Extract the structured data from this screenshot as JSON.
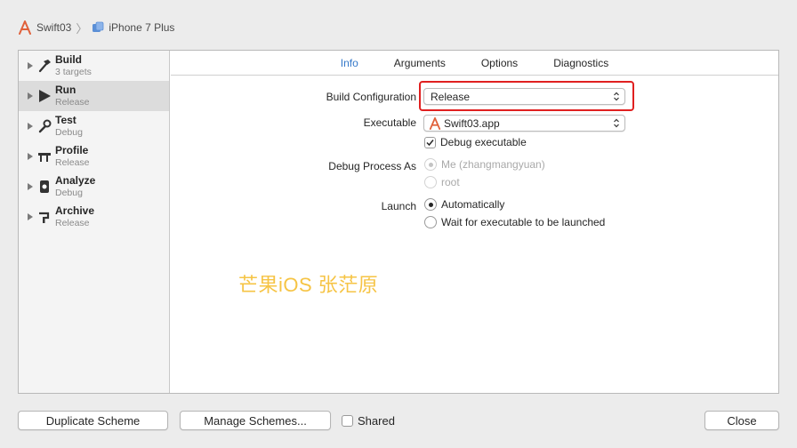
{
  "breadcrumb": {
    "project": "Swift03",
    "device": "iPhone 7 Plus"
  },
  "sidebar": {
    "items": [
      {
        "name": "Build",
        "sub": "3 targets",
        "icon": "hammer-icon"
      },
      {
        "name": "Run",
        "sub": "Release",
        "icon": "play-icon"
      },
      {
        "name": "Test",
        "sub": "Debug",
        "icon": "wrench-icon"
      },
      {
        "name": "Profile",
        "sub": "Release",
        "icon": "instruments-icon"
      },
      {
        "name": "Analyze",
        "sub": "Debug",
        "icon": "analyze-icon"
      },
      {
        "name": "Archive",
        "sub": "Release",
        "icon": "archive-icon"
      }
    ],
    "selected": "Run"
  },
  "tabs": [
    "Info",
    "Arguments",
    "Options",
    "Diagnostics"
  ],
  "active_tab": "Info",
  "info": {
    "build_configuration_label": "Build Configuration",
    "build_configuration_value": "Release",
    "executable_label": "Executable",
    "executable_value": "Swift03.app",
    "debug_executable_label": "Debug executable",
    "debug_executable_checked": true,
    "debug_process_as_label": "Debug Process As",
    "debug_process_options": [
      "Me (zhangmangyuan)",
      "root"
    ],
    "launch_label": "Launch",
    "launch_options": [
      "Automatically",
      "Wait for executable to be launched"
    ]
  },
  "watermark": "芒果iOS 张茫原",
  "footer": {
    "duplicate": "Duplicate Scheme",
    "manage": "Manage Schemes...",
    "shared": "Shared",
    "close": "Close"
  },
  "colors": {
    "accent": "#3478c9",
    "highlight": "#e02020",
    "watermark": "#f6c445"
  }
}
